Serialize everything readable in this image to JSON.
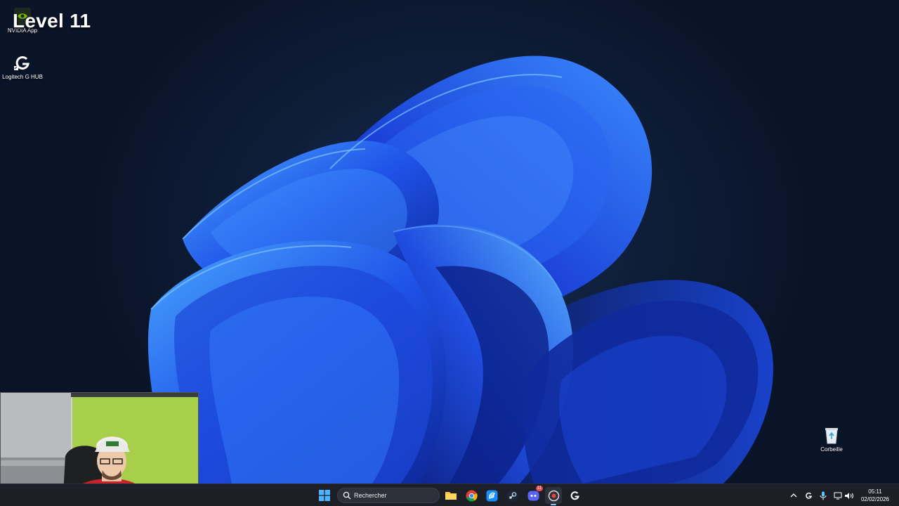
{
  "overlay": {
    "title": "Level 11"
  },
  "desktop": {
    "icons": [
      {
        "label": "NVIDIA App",
        "icon": "nvidia-icon"
      },
      {
        "label": "Logitech G HUB",
        "icon": "logitech-g-icon"
      },
      {
        "label": "Corbeille",
        "icon": "recycle-bin-icon"
      }
    ]
  },
  "taskbar": {
    "search": {
      "placeholder": "Rechercher"
    },
    "apps": [
      {
        "name": "start",
        "icon": "windows-start-icon"
      },
      {
        "name": "file-explorer",
        "icon": "folder-icon"
      },
      {
        "name": "chrome",
        "icon": "chrome-icon"
      },
      {
        "name": "battle-net",
        "icon": "battle-net-icon"
      },
      {
        "name": "steam",
        "icon": "steam-icon"
      },
      {
        "name": "discord",
        "icon": "discord-icon",
        "badge": "11"
      },
      {
        "name": "recorder",
        "icon": "record-icon"
      },
      {
        "name": "g-hub",
        "icon": "logitech-g-icon"
      }
    ],
    "clock": {
      "time": "05:11",
      "date": "02/02/2026"
    }
  },
  "colors": {
    "accent": "#2f6bff",
    "taskbar": "#1c1f26",
    "background": "#0a1428"
  }
}
